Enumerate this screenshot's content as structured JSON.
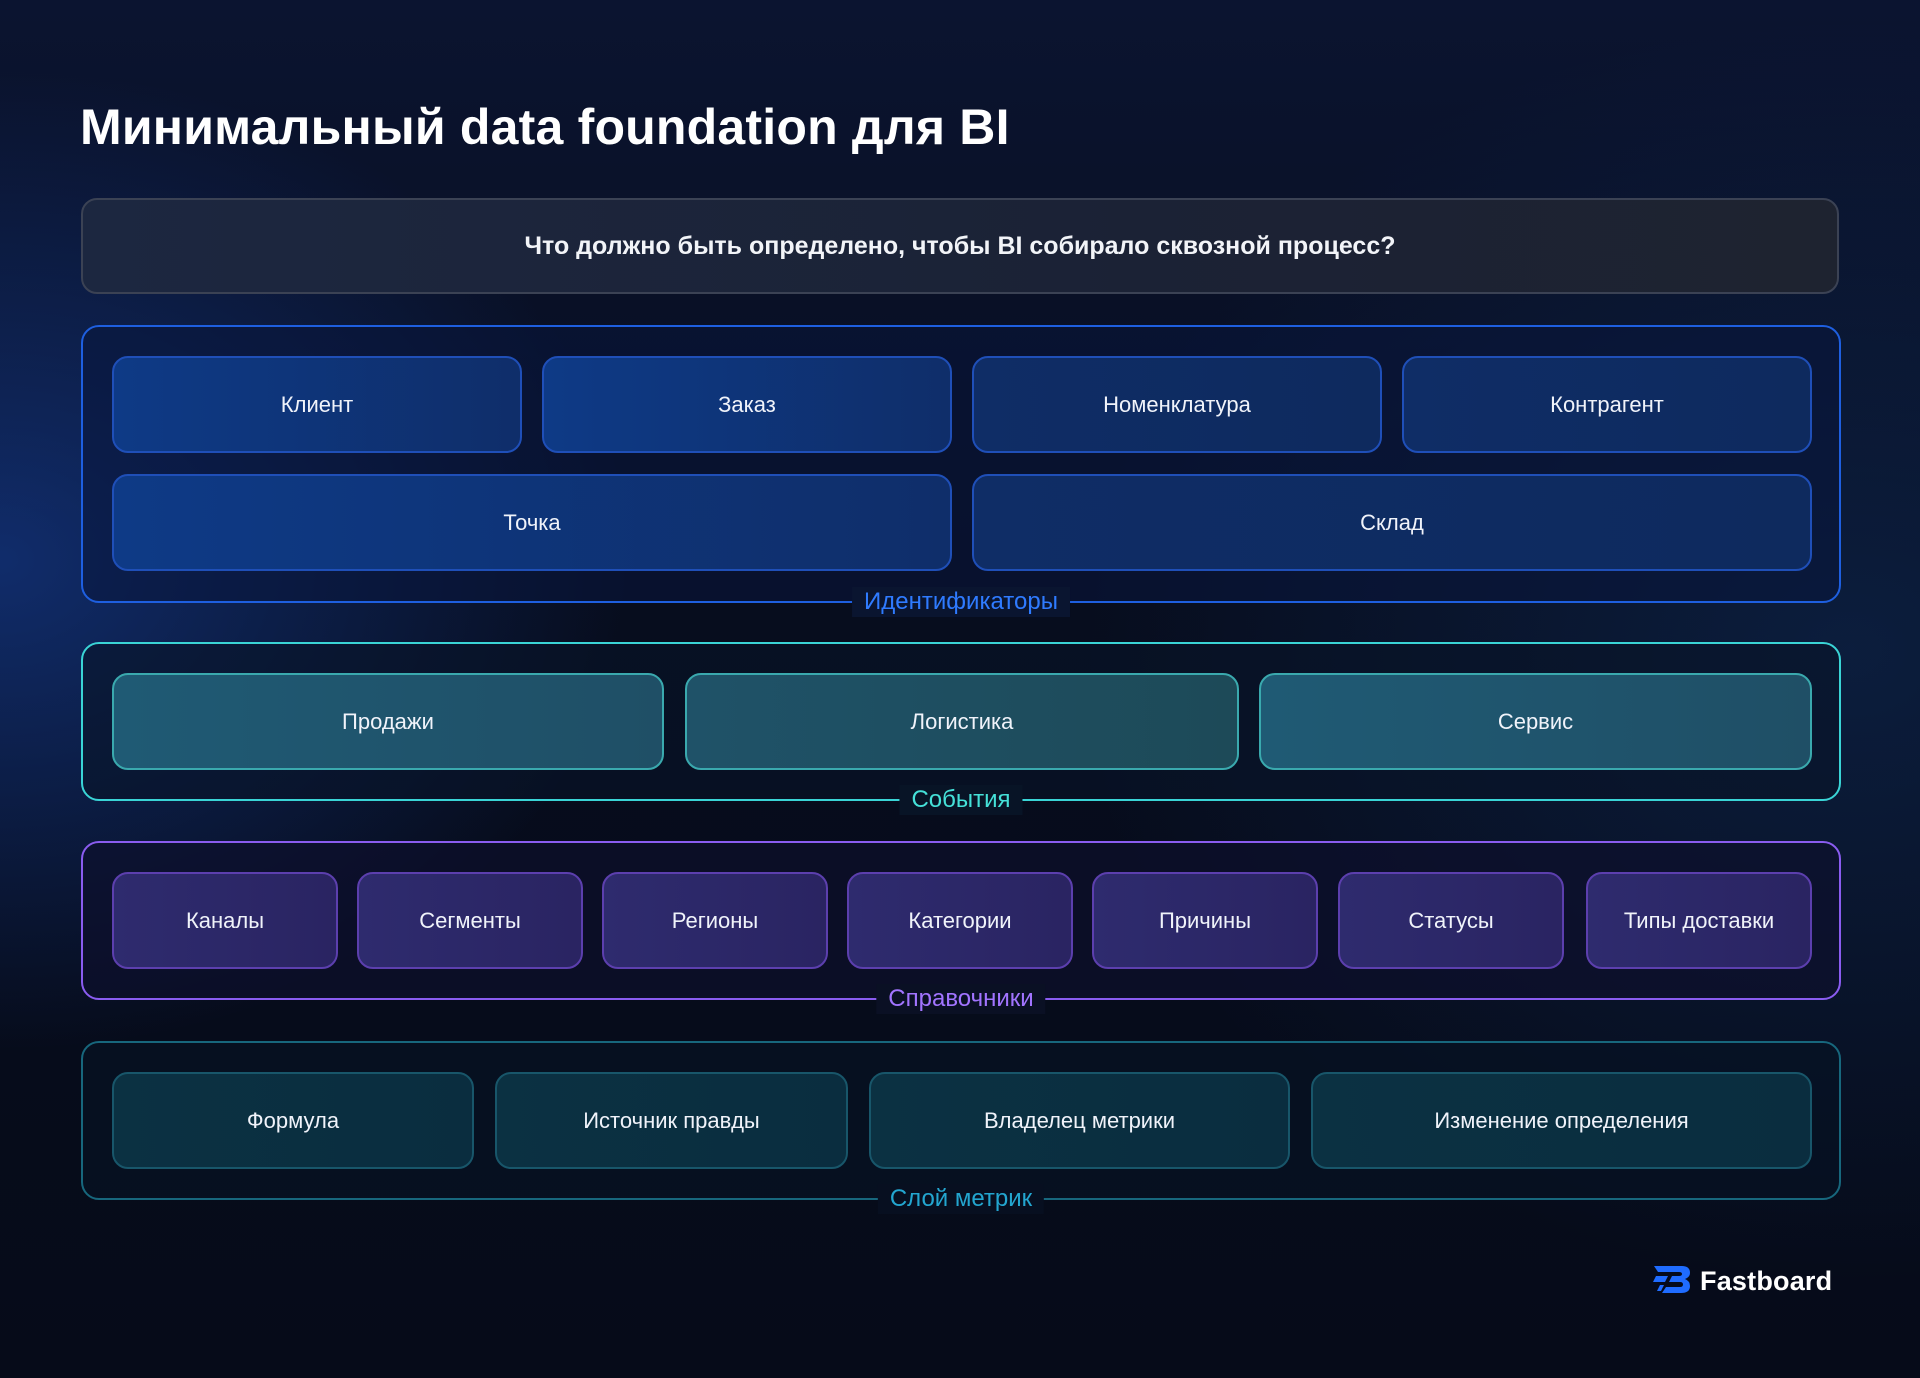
{
  "title": "Минимальный data foundation для BI",
  "question": "Что должно быть определено, чтобы BI собирало сквозной процесс?",
  "identifiers": {
    "label": "Идентификаторы",
    "items": [
      "Клиент",
      "Заказ",
      "Номенклатура",
      "Контрагент",
      "Точка",
      "Склад"
    ]
  },
  "events": {
    "label": "События",
    "items": [
      "Продажи",
      "Логистика",
      "Сервис"
    ]
  },
  "dictionaries": {
    "label": "Справочники",
    "items": [
      "Каналы",
      "Сегменты",
      "Регионы",
      "Категории",
      "Причины",
      "Статусы",
      "Типы доставки"
    ]
  },
  "metrics": {
    "label": "Слой метрик",
    "items": [
      "Формула",
      "Источник правды",
      "Владелец метрики",
      "Изменение определения"
    ]
  },
  "brand": {
    "name": "Fastboard",
    "icon": "fastboard-logo-icon"
  },
  "colors": {
    "identifiers_accent": "#2f7bff",
    "events_accent": "#45e0d8",
    "dictionaries_accent": "#a274ff",
    "metrics_accent": "#23a6d0"
  }
}
